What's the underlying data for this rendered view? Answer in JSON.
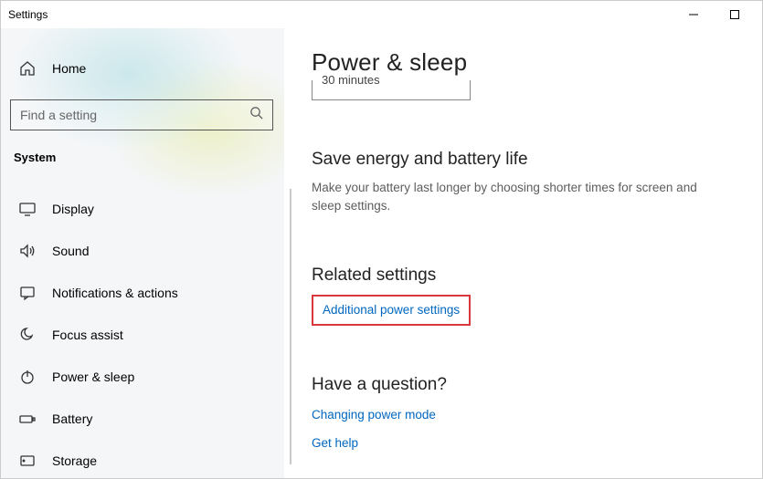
{
  "window": {
    "title": "Settings"
  },
  "sidebar": {
    "home": "Home",
    "search_placeholder": "Find a setting",
    "category": "System",
    "items": [
      {
        "label": "Display"
      },
      {
        "label": "Sound"
      },
      {
        "label": "Notifications & actions"
      },
      {
        "label": "Focus assist"
      },
      {
        "label": "Power & sleep"
      },
      {
        "label": "Battery"
      },
      {
        "label": "Storage"
      }
    ]
  },
  "main": {
    "title": "Power & sleep",
    "dropdown_partial_value": "30 minutes",
    "save_energy": {
      "title": "Save energy and battery life",
      "desc": "Make your battery last longer by choosing shorter times for screen and sleep settings."
    },
    "related": {
      "title": "Related settings",
      "link": "Additional power settings"
    },
    "question": {
      "title": "Have a question?",
      "link1": "Changing power mode",
      "link2": "Get help"
    }
  }
}
